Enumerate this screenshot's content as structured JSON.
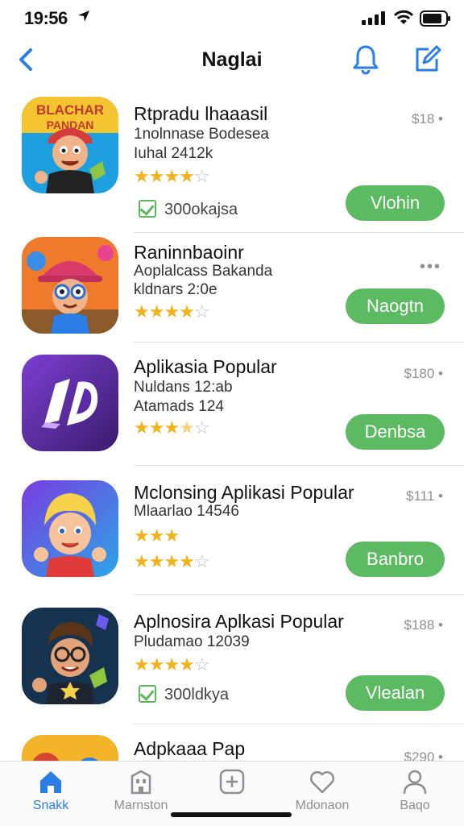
{
  "status_bar": {
    "time": "19:56"
  },
  "nav": {
    "title": "Naglai"
  },
  "apps": [
    {
      "title": "Rtpradu lhaaasil",
      "sub1": "1nolnnase Bodesea",
      "sub2": "Iuhal  2412k",
      "rating": 4,
      "price": "$18 •",
      "badge": "300okajsa",
      "button": "Vlohin"
    },
    {
      "title": "Raninnbaoinr",
      "sub1": "Aoplalcass Bakanda",
      "sub2": "kldnars 2:0e",
      "rating": 4,
      "more": "•••",
      "button": "Naogtn"
    },
    {
      "title": "Aplikasia Popular",
      "sub1": "Nuldans 12:ab",
      "sub2": "Atamads 124",
      "rating": 3.5,
      "price": "$180 •",
      "button": "Denbsa"
    },
    {
      "title": "Mclonsing Aplikasi Popular",
      "sub1": "Mlaarlao 14546",
      "sub2": "",
      "rating": 4,
      "price": "$111 •",
      "button": "Banbro"
    },
    {
      "title": "Aplnosira Aplkasi Popular",
      "sub1": "Pludamao 12039",
      "sub2": "",
      "rating": 4,
      "price": "$188 •",
      "badge": "300ldkya",
      "button": "Vlealan"
    },
    {
      "title": "Adpkaaa Pap",
      "price": "$290 •"
    }
  ],
  "icon_art": {
    "app1": "BLACHAR PANDAN",
    "app1_colors": [
      "#1ea0e0",
      "#f4c531"
    ],
    "app3_colors": [
      "#4a2585",
      "#7b3fd0"
    ]
  },
  "tabs": [
    {
      "label": "Snakk",
      "icon": "home-icon",
      "active": true
    },
    {
      "label": "Marnston",
      "icon": "building-icon"
    },
    {
      "label": "",
      "icon": "plus-icon"
    },
    {
      "label": "Mdonaon",
      "icon": "heart-icon"
    },
    {
      "label": "Baqo",
      "icon": "person-icon"
    }
  ],
  "colors": {
    "accent": "#2a7ee6",
    "button": "#5cba63",
    "star": "#f3b21b"
  }
}
